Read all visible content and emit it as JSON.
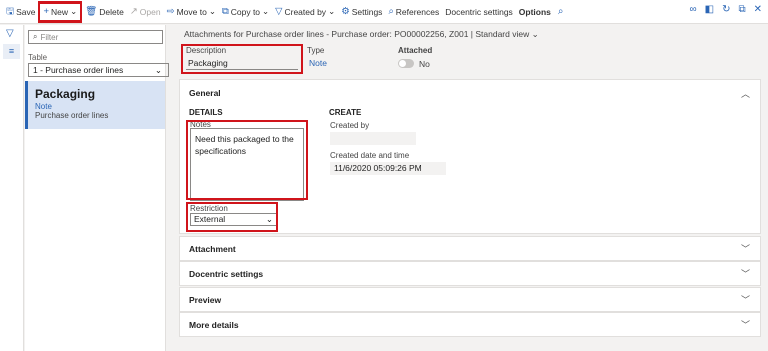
{
  "toolbar": {
    "save": "Save",
    "new": "New",
    "delete": "Delete",
    "open": "Open",
    "move_to": "Move to",
    "copy_to": "Copy to",
    "created_by": "Created by",
    "settings": "Settings",
    "references": "References",
    "docentric": "Docentric settings",
    "options": "Options"
  },
  "filter": {
    "placeholder": "Filter",
    "table_label": "Table",
    "table_value": "1 - Purchase order lines"
  },
  "list": {
    "title": "Packaging",
    "type": "Note",
    "source": "Purchase order lines"
  },
  "breadcrumb": "Attachments for Purchase order lines - Purchase order: PO00002256, Z001  |  Standard view",
  "header": {
    "description_label": "Description",
    "description_value": "Packaging",
    "type_label": "Type",
    "type_value": "Note",
    "attached_label": "Attached",
    "attached_value": "No"
  },
  "general": {
    "title": "General",
    "details_title": "DETAILS",
    "notes_label": "Notes",
    "notes_value": "Need this packaged to the specifications",
    "restriction_label": "Restriction",
    "restriction_value": "External",
    "create_title": "CREATE",
    "created_by_label": "Created by",
    "created_by_value": "",
    "created_date_label": "Created date and time",
    "created_date_value": "11/6/2020 05:09:26 PM"
  },
  "sections": {
    "attachment": "Attachment",
    "docentric": "Docentric settings",
    "preview": "Preview",
    "more_details": "More details"
  },
  "colors": {
    "accent": "#2a65b5",
    "highlight": "#d0141b",
    "selected_row": "#d8e3f4"
  }
}
